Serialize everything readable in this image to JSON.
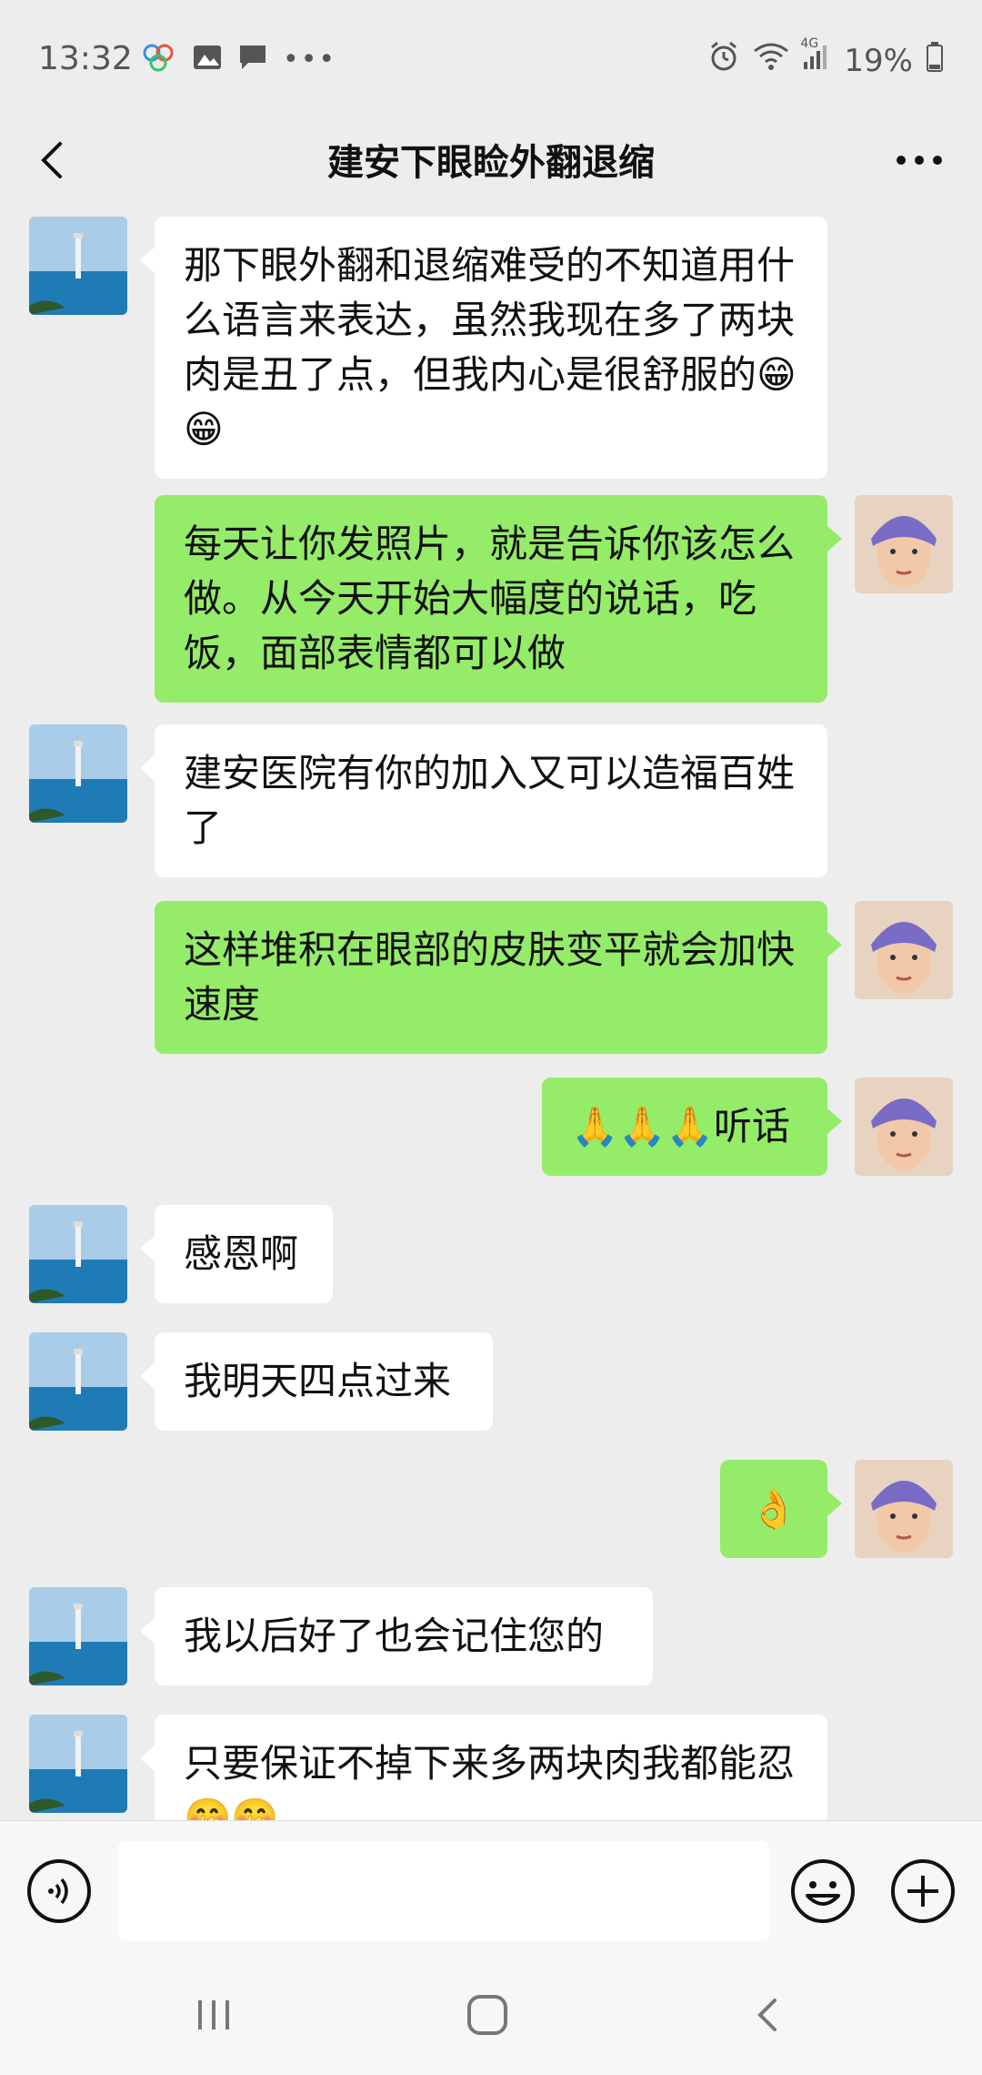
{
  "status": {
    "time": "13:32",
    "network": "4G",
    "battery": "19%"
  },
  "header": {
    "title": "建安下眼睑外翻退缩"
  },
  "messages": [
    {
      "side": "left",
      "text": "那下眼外翻和退缩难受的不知道用什么语言来表达，虽然我现在多了两块肉是丑了点，但我内心是很舒服的😁😁"
    },
    {
      "side": "right",
      "text": "每天让你发照片，就是告诉你该怎么做。从今天开始大幅度的说话，吃饭，面部表情都可以做"
    },
    {
      "side": "left",
      "text": "建安医院有你的加入又可以造福百姓了"
    },
    {
      "side": "right",
      "text": "这样堆积在眼部的皮肤变平就会加快速度"
    },
    {
      "side": "right",
      "text": "🙏🙏🙏听话"
    },
    {
      "side": "left",
      "text": "感恩啊"
    },
    {
      "side": "left",
      "text": "我明天四点过来"
    },
    {
      "side": "right",
      "text": "👌"
    },
    {
      "side": "left",
      "text": "我以后好了也会记住您的"
    },
    {
      "side": "left",
      "text": "只要保证不掉下来多两块肉我都能忍🤭🤭"
    }
  ],
  "colors": {
    "background": "#ededed",
    "self_bubble": "#95ec69",
    "other_bubble": "#ffffff"
  }
}
